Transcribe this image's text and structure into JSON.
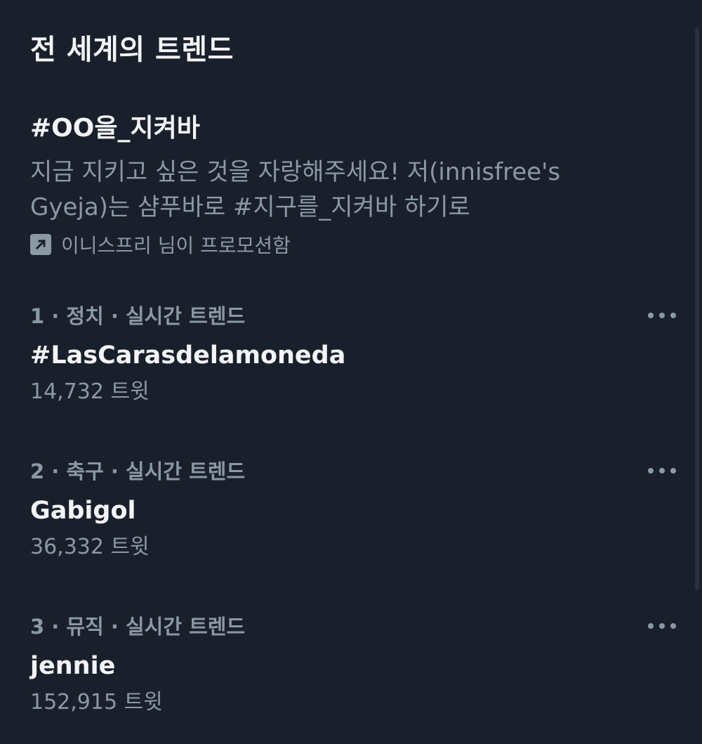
{
  "header": {
    "title": "전 세계의 트렌드"
  },
  "promoted": {
    "title": "#OO을_지켜바",
    "description": "지금 지키고 싶은 것을 자랑해주세요! 저(innisfree's Gyeja)는 샴푸바로 #지구를_지켜바 하기로",
    "promoted_by": "이니스프리 님이 프로모션함",
    "icon": "promoted-arrow-icon"
  },
  "trends": [
    {
      "meta": "1 · 정치 · 실시간 트렌드",
      "name": "#LasCarasdelamoneda",
      "count": "14,732 트윗"
    },
    {
      "meta": "2 · 축구 · 실시간 트렌드",
      "name": "Gabigol",
      "count": "36,332 트윗"
    },
    {
      "meta": "3 · 뮤직 · 실시간 트렌드",
      "name": "jennie",
      "count": "152,915 트윗"
    }
  ],
  "colors": {
    "background": "#1a202b",
    "primary_text": "#f3f4f5",
    "secondary_text": "#8b98a5"
  }
}
